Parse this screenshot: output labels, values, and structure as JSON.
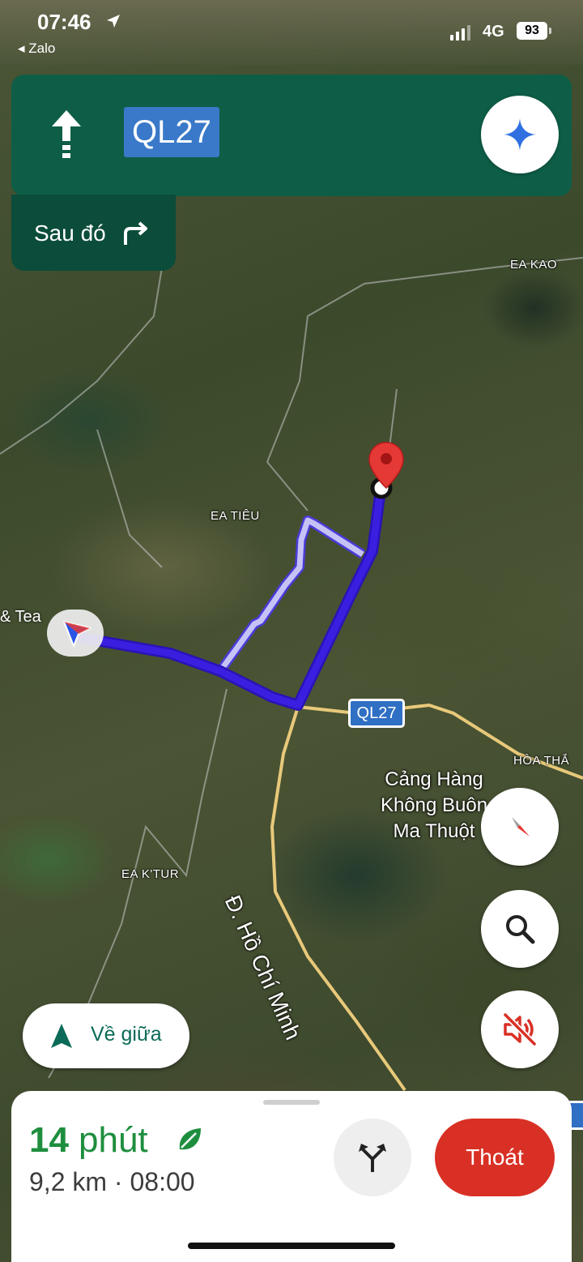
{
  "status_bar": {
    "time": "07:46",
    "back_app": "◂ Zalo",
    "network": "4G",
    "battery": "93"
  },
  "navigation": {
    "road_badge": "QL27",
    "then_label": "Sau đó",
    "turn_icon": "straight-arrow-icon",
    "then_icon": "turn-right-icon"
  },
  "map": {
    "labels": {
      "ea_kao": "EA KAO",
      "ea_tieu": "EA TIÊU",
      "ea_ktur": "EA K'TUR",
      "hoa_thang": "HÒA THẮ",
      "poi_partial": "& Tea",
      "road_shield": "QL27",
      "road_name": "Đ. Hồ Chí Minh",
      "airport_line1": "Cảng Hàng",
      "airport_line2": "Không Buôn",
      "airport_line3": "Ma Thuột"
    },
    "route_color": "#3b1fe0",
    "alt_route_color": "#b9b4f3"
  },
  "controls": {
    "recenter_label": "Về giữa"
  },
  "trip": {
    "minutes": "14",
    "minutes_unit": "phút",
    "distance_eta": "9,2 km · 08:00",
    "exit_label": "Thoát",
    "eta_color": "#1e8e3e",
    "exit_color": "#d93025"
  }
}
